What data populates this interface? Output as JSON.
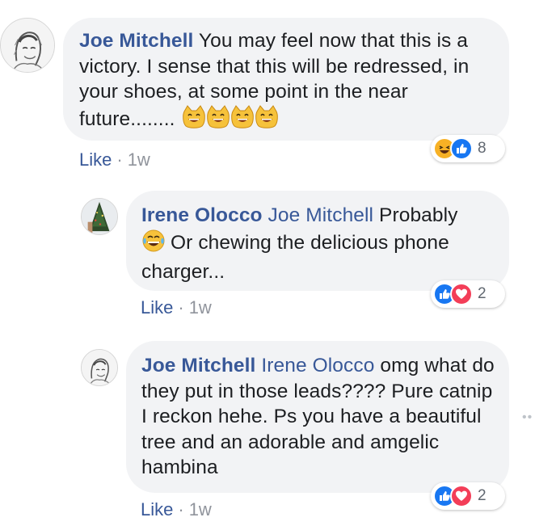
{
  "comments": [
    {
      "author": "Joe Mitchell",
      "text": "You may feel now that this is a victory. I sense that this will be redressed, in your shoes, at some point in the near future........",
      "emoji": [
        "grinning-cat-emoji",
        "grinning-cat-emoji",
        "grinning-cat-emoji",
        "grinning-cat-emoji"
      ],
      "like_label": "Like",
      "time": "1w",
      "reactions": {
        "icons": [
          "haha",
          "like"
        ],
        "count": "8"
      }
    },
    {
      "author": "Irene Olocco",
      "mention": "Joe Mitchell",
      "text_before_emoji": "Probably",
      "text_after_emoji": "Or chewing the delicious phone charger...",
      "emoji": "tears-of-joy-emoji",
      "like_label": "Like",
      "time": "1w",
      "reactions": {
        "icons": [
          "like",
          "love"
        ],
        "count": "2"
      }
    },
    {
      "author": "Joe Mitchell",
      "mention": "Irene Olocco",
      "text": "omg what do they put in those leads???? Pure catnip I reckon hehe. Ps you have a beautiful tree and an adorable and amgelic hambina",
      "like_label": "Like",
      "time": "1w",
      "reactions": {
        "icons": [
          "like",
          "love"
        ],
        "count": "2"
      }
    }
  ],
  "colors": {
    "bubble": "#f2f3f5",
    "link": "#385898",
    "meta": "#90949c",
    "like_reaction": "#1877f2",
    "love_reaction": "#f33e58",
    "haha_reaction": "#f7b125"
  }
}
